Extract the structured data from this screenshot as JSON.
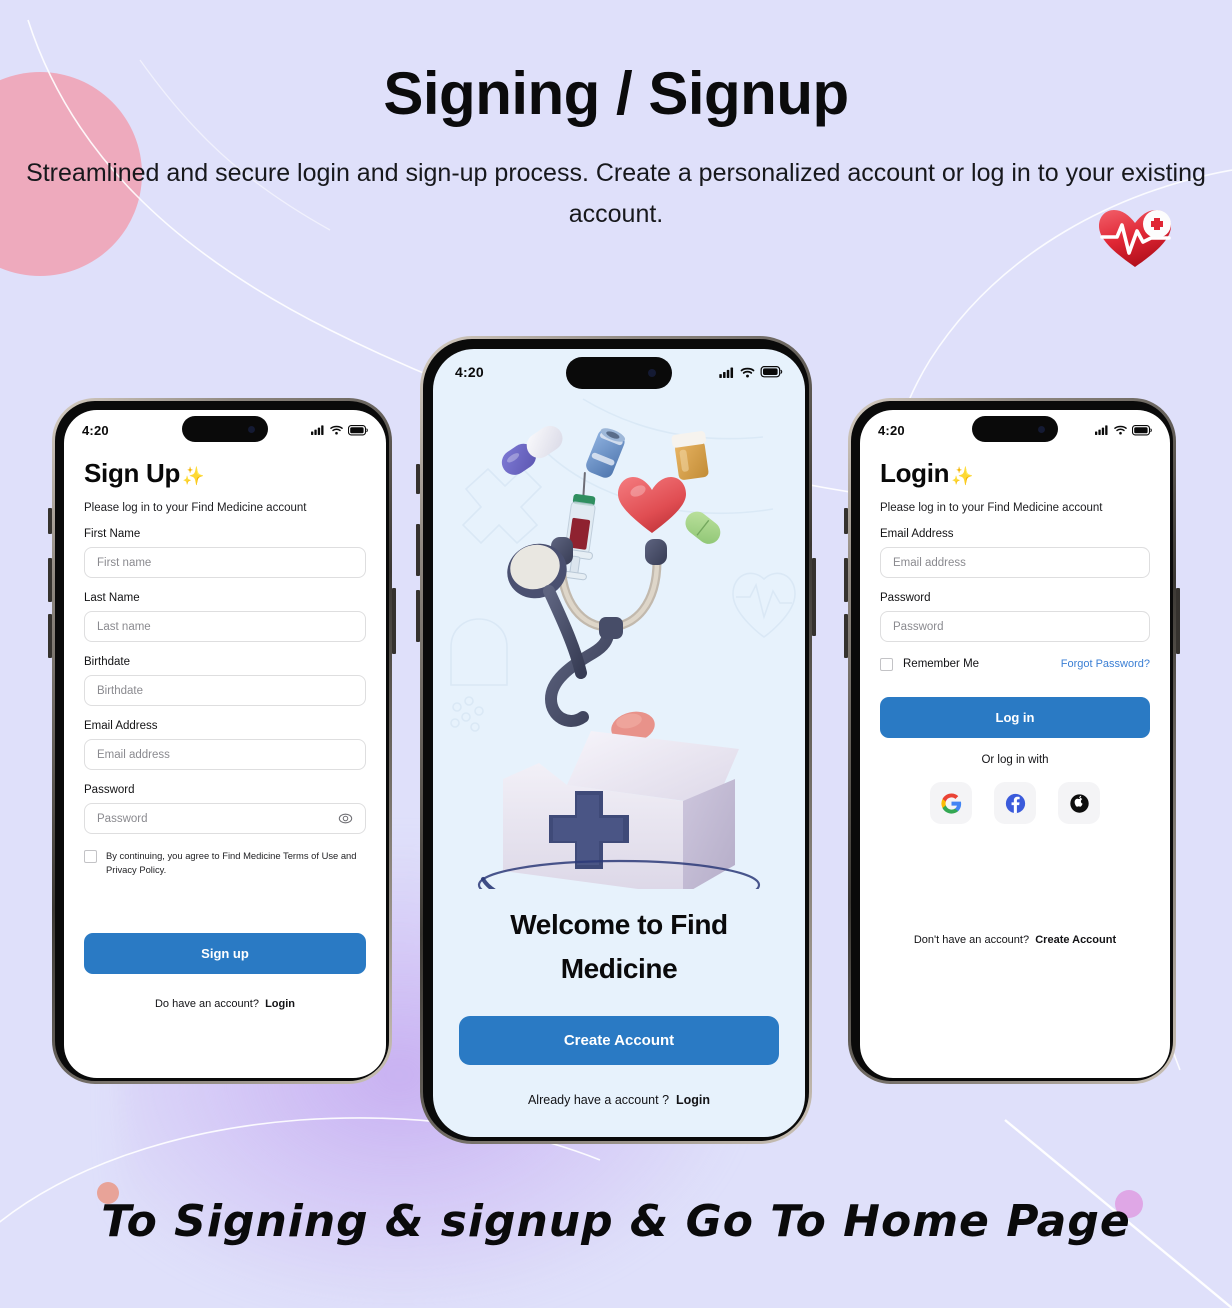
{
  "header": {
    "title": "Signing / Signup",
    "subtitle": "Streamlined and secure login and sign-up process. Create a personalized account or log in to your existing account."
  },
  "footer": {
    "caption": "To Signing & signup & Go To Home Page"
  },
  "colors": {
    "page_background": "#dfe0fa",
    "primary_button": "#2a7ac4",
    "link": "#3b7fd4",
    "welcome_screen_background": "#e7f2fc",
    "accent_pink": "#eeaabd",
    "accent_orchid": "#dfa7e6",
    "accent_salmon": "#e8a398"
  },
  "statusbar": {
    "time": "4:20",
    "icons": [
      "cellular-icon",
      "wifi-icon",
      "battery-icon"
    ]
  },
  "signup_screen": {
    "title": "Sign Up",
    "title_emoji": "✨",
    "subtitle": "Please log in to your Find Medicine account",
    "fields": [
      {
        "label": "First Name",
        "placeholder": "First name",
        "has_eye": false
      },
      {
        "label": "Last Name",
        "placeholder": "Last name",
        "has_eye": false
      },
      {
        "label": "Birthdate",
        "placeholder": "Birthdate",
        "has_eye": false
      },
      {
        "label": "Email Address",
        "placeholder": "Email address",
        "has_eye": false
      },
      {
        "label": "Password",
        "placeholder": "Password",
        "has_eye": true
      }
    ],
    "terms_text": "By continuing, you agree to Find Medicine Terms of Use and Privacy Policy.",
    "terms_checked": false,
    "submit_label": "Sign up",
    "footer_prompt": "Do have an account?",
    "footer_link": "Login"
  },
  "welcome_screen": {
    "title": "Welcome to Find Medicine",
    "cta_label": "Create Account",
    "footer_prompt": "Already have a account ?",
    "footer_link": "Login",
    "illustration": "medical-kit-illustration"
  },
  "login_screen": {
    "title": "Login",
    "title_emoji": "✨",
    "subtitle": "Please log in to your Find Medicine account",
    "fields": [
      {
        "label": "Email Address",
        "placeholder": "Email address"
      },
      {
        "label": "Password",
        "placeholder": "Password"
      }
    ],
    "remember_label": "Remember Me",
    "remember_checked": false,
    "forgot_label": "Forgot Password?",
    "submit_label": "Log in",
    "or_label": "Or log in with",
    "social_buttons": [
      {
        "name": "google-icon"
      },
      {
        "name": "facebook-icon"
      },
      {
        "name": "apple-icon"
      }
    ],
    "footer_prompt": "Don't have an account?",
    "footer_link": "Create Account"
  }
}
